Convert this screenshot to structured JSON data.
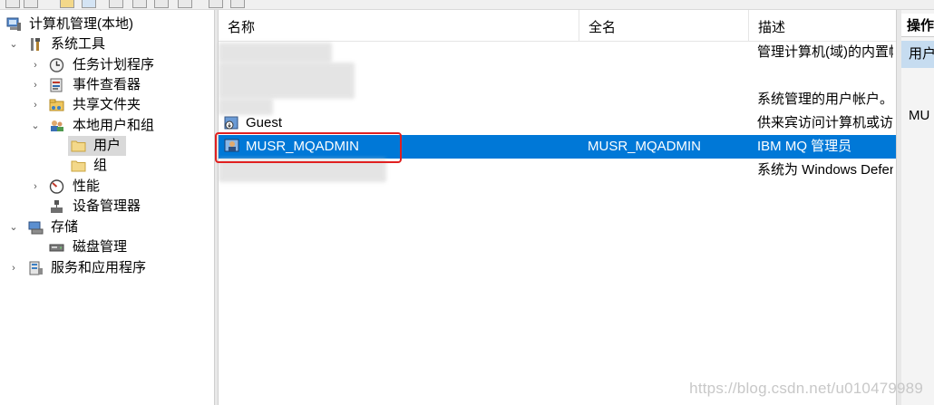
{
  "tree": {
    "root": "计算机管理(本地)",
    "system_tools": "系统工具",
    "task_scheduler": "任务计划程序",
    "event_viewer": "事件查看器",
    "shared_folders": "共享文件夹",
    "local_users_groups": "本地用户和组",
    "users": "用户",
    "groups": "组",
    "performance": "性能",
    "device_manager": "设备管理器",
    "storage": "存储",
    "disk_management": "磁盘管理",
    "services_apps": "服务和应用程序"
  },
  "list": {
    "columns": [
      "名称",
      "全名",
      "描述"
    ],
    "rows": [
      {
        "name": "",
        "fullname": "",
        "desc": "管理计算机(域)的内置帐"
      },
      {
        "name": "",
        "fullname": "",
        "desc": ""
      },
      {
        "name": "",
        "fullname": "",
        "desc": "系统管理的用户帐户。"
      },
      {
        "name": "Guest",
        "fullname": "",
        "desc": "供来宾访问计算机或访"
      },
      {
        "name": "MUSR_MQADMIN",
        "fullname": "MUSR_MQADMIN",
        "desc": "IBM MQ 管理员"
      },
      {
        "name": "",
        "fullname": "",
        "desc": "系统为 Windows Defen"
      }
    ]
  },
  "actions": {
    "header": "操作",
    "selected": "用户",
    "item": "MU"
  },
  "watermark": "https://blog.csdn.net/u010479989",
  "colors": {
    "selection": "#0078d7",
    "highlight_box": "#e02020"
  }
}
